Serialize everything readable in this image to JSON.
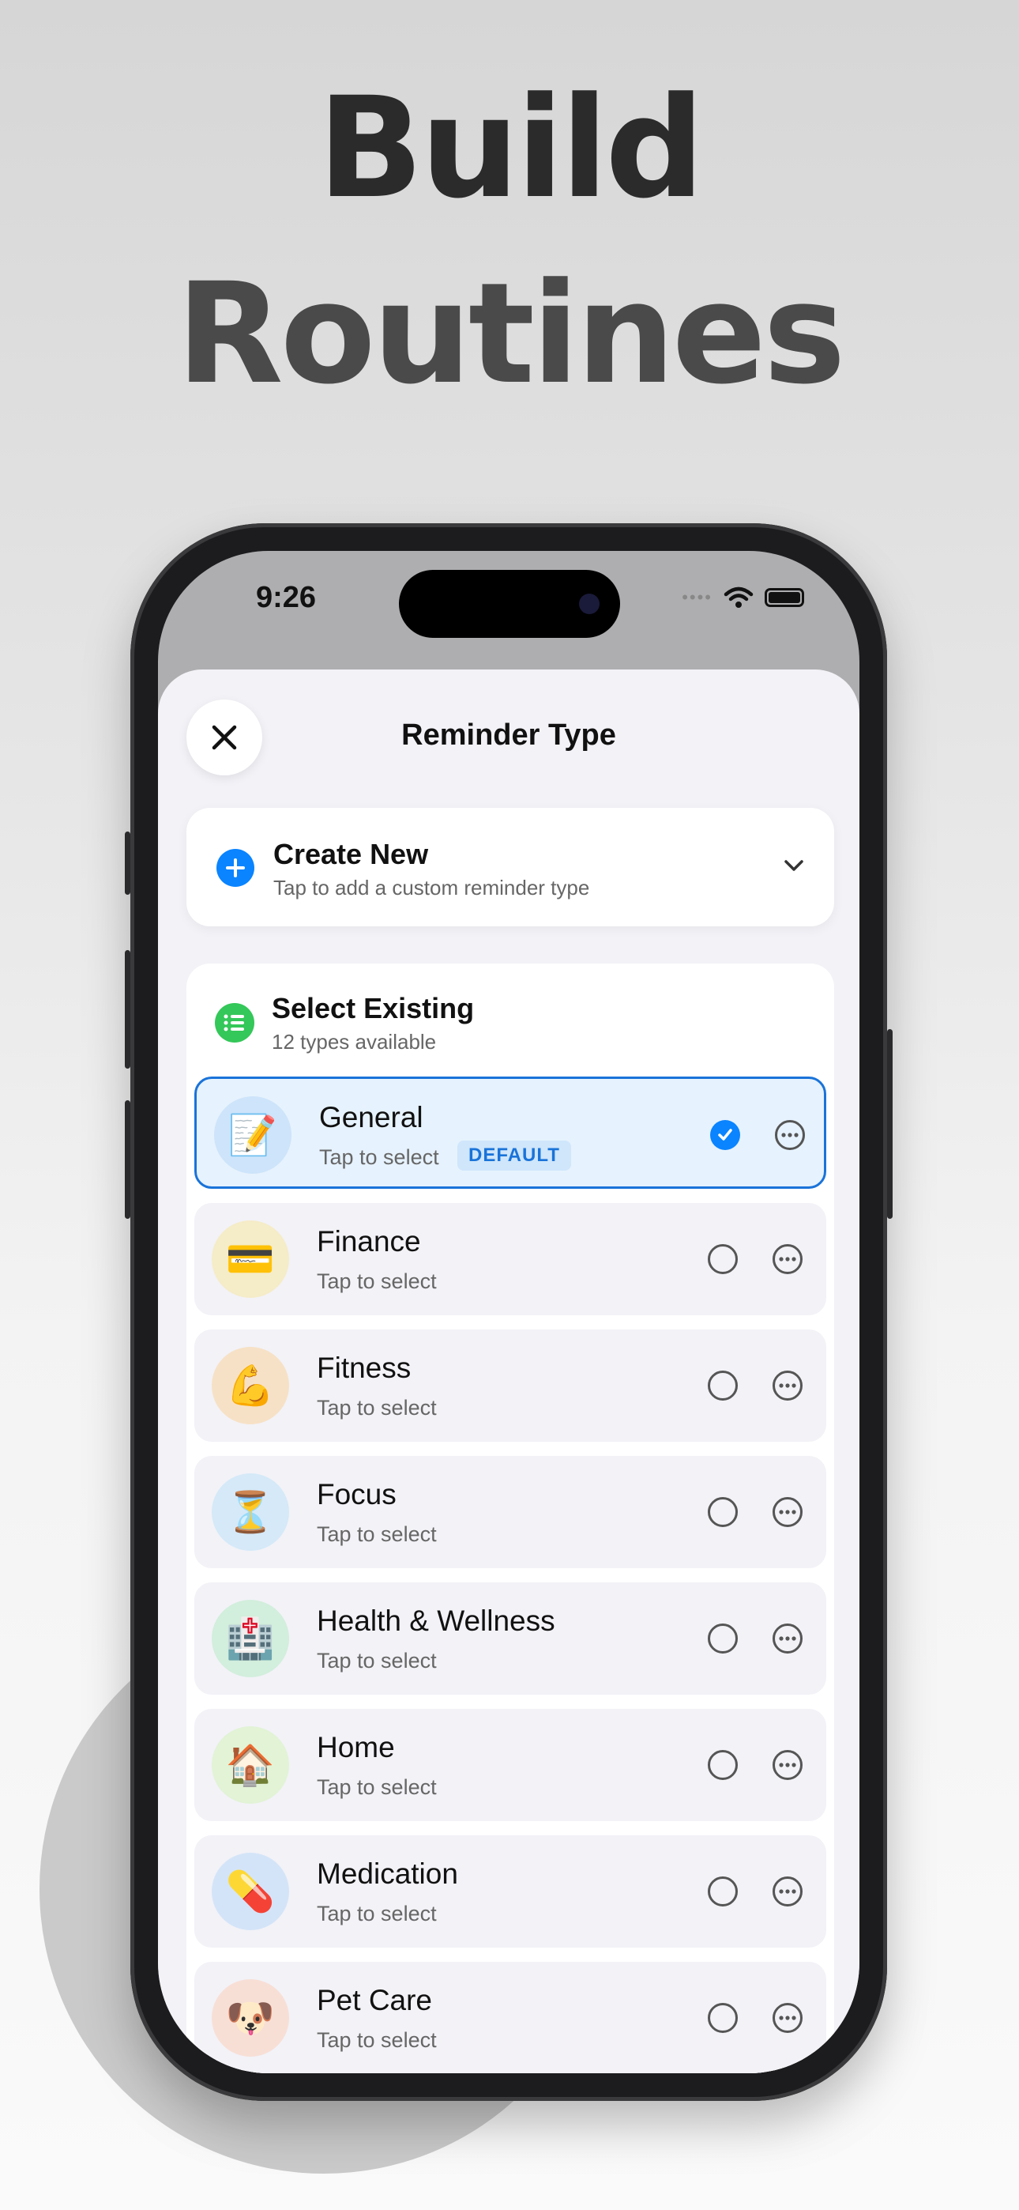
{
  "headline": {
    "line1": "Build",
    "line2": "Routines"
  },
  "status_bar": {
    "time": "9:26"
  },
  "sheet": {
    "title": "Reminder Type"
  },
  "create_new": {
    "title": "Create New",
    "subtitle": "Tap to add a custom reminder type"
  },
  "select_existing": {
    "title": "Select Existing",
    "subtitle": "12 types available"
  },
  "types": [
    {
      "name": "General",
      "subtitle": "Tap to select",
      "badge": "DEFAULT",
      "emoji": "📝",
      "selected": true,
      "bg": "#cde4fa"
    },
    {
      "name": "Finance",
      "subtitle": "Tap to select",
      "emoji": "💳",
      "selected": false,
      "bg": "#f5ecc8"
    },
    {
      "name": "Fitness",
      "subtitle": "Tap to select",
      "emoji": "💪",
      "selected": false,
      "bg": "#f7e1c6"
    },
    {
      "name": "Focus",
      "subtitle": "Tap to select",
      "emoji": "⏳",
      "selected": false,
      "bg": "#d5e9f8"
    },
    {
      "name": "Health & Wellness",
      "subtitle": "Tap to select",
      "emoji": "🏥",
      "selected": false,
      "bg": "#d2eedc"
    },
    {
      "name": "Home",
      "subtitle": "Tap to select",
      "emoji": "🏠",
      "selected": false,
      "bg": "#e2f3d6"
    },
    {
      "name": "Medication",
      "subtitle": "Tap to select",
      "emoji": "💊",
      "selected": false,
      "bg": "#d4e4f8"
    },
    {
      "name": "Pet Care",
      "subtitle": "Tap to select",
      "emoji": "🐶",
      "selected": false,
      "bg": "#f8dfd6"
    }
  ],
  "colors": {
    "accent": "#0a84ff",
    "selected_border": "#1a73d9",
    "list_icon": "#34c759"
  }
}
